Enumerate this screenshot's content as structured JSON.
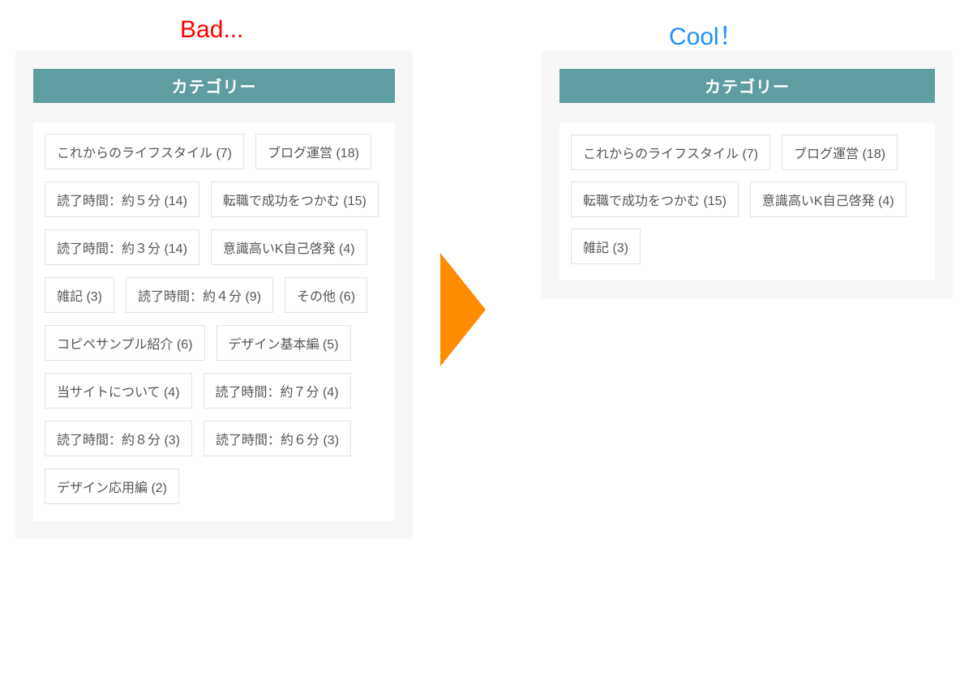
{
  "labels": {
    "bad": "Bad...",
    "cool": "Cool！",
    "categoryHeader": "カテゴリー"
  },
  "bad": {
    "tags": [
      {
        "name": "これからのライフスタイル",
        "count": 7
      },
      {
        "name": "ブログ運営",
        "count": 18
      },
      {
        "name": "読了時間：約５分",
        "count": 14
      },
      {
        "name": "転職で成功をつかむ",
        "count": 15
      },
      {
        "name": "読了時間：約３分",
        "count": 14
      },
      {
        "name": "意識高いK自己啓発",
        "count": 4
      },
      {
        "name": "雑記",
        "count": 3
      },
      {
        "name": "読了時間：約４分",
        "count": 9
      },
      {
        "name": "その他",
        "count": 6
      },
      {
        "name": "コピペサンプル紹介",
        "count": 6
      },
      {
        "name": "デザイン基本編",
        "count": 5
      },
      {
        "name": "当サイトについて",
        "count": 4
      },
      {
        "name": "読了時間：約７分",
        "count": 4
      },
      {
        "name": "読了時間：約８分",
        "count": 3
      },
      {
        "name": "読了時間：約６分",
        "count": 3
      },
      {
        "name": "デザイン応用編",
        "count": 2
      }
    ]
  },
  "cool": {
    "tags": [
      {
        "name": "これからのライフスタイル",
        "count": 7
      },
      {
        "name": "ブログ運営",
        "count": 18
      },
      {
        "name": "転職で成功をつかむ",
        "count": 15
      },
      {
        "name": "意識高いK自己啓発",
        "count": 4
      },
      {
        "name": "雑記",
        "count": 3
      }
    ]
  }
}
